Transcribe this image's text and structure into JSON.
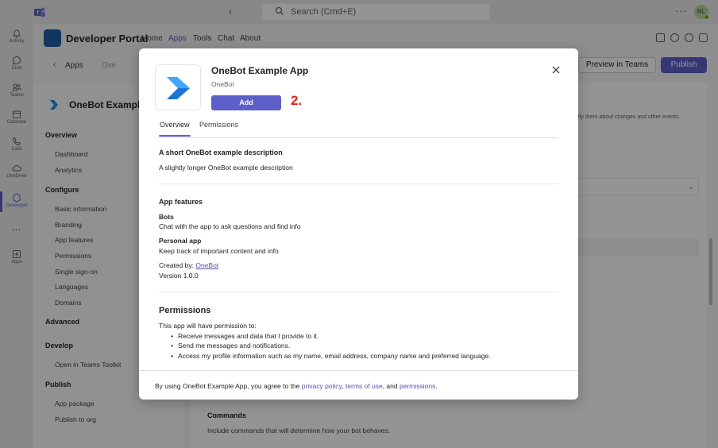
{
  "topbar": {
    "search_placeholder": "Search (Cmd+E)",
    "more": "···",
    "avatar_initials": "RL"
  },
  "rail": {
    "items": [
      {
        "label": "Activity",
        "icon": "bell-icon"
      },
      {
        "label": "Chat",
        "icon": "chat-icon"
      },
      {
        "label": "Teams",
        "icon": "teams-icon"
      },
      {
        "label": "Calendar",
        "icon": "calendar-icon"
      },
      {
        "label": "Calls",
        "icon": "phone-icon"
      },
      {
        "label": "OneDrive",
        "icon": "cloud-icon"
      },
      {
        "label": "Developer",
        "icon": "developer-portal-icon"
      },
      {
        "label": "",
        "icon": "more-icon"
      },
      {
        "label": "Apps",
        "icon": "apps-icon"
      }
    ]
  },
  "header": {
    "title": "Developer Portal",
    "nav": [
      "Home",
      "Apps",
      "Tools",
      "Chat",
      "About"
    ],
    "active_nav": "Apps"
  },
  "subbar": {
    "back": "‹",
    "apps": "Apps",
    "crumb": "Ove",
    "preview_label": "Preview in Teams",
    "publish_label": "Publish"
  },
  "leftnav": {
    "app_name": "OneBot Example",
    "sections": [
      {
        "title": "Overview",
        "items": [
          "Dashboard",
          "Analytics"
        ]
      },
      {
        "title": "Configure",
        "items": [
          "Basic information",
          "Branding",
          "App features",
          "Permissions",
          "Single sign-on",
          "Languages",
          "Domains"
        ]
      },
      {
        "title": "Advanced",
        "items": []
      },
      {
        "title": "Develop",
        "items": [
          "Open in Teams Toolkit"
        ]
      },
      {
        "title": "Publish",
        "items": [
          "App package",
          "Publish to org"
        ]
      }
    ]
  },
  "main": {
    "hint": "ify them about changes and other events.",
    "commands_title": "Commands",
    "commands_desc": "Include commands that will determine how your bot behaves."
  },
  "dialog": {
    "title": "OneBot Example App",
    "developer": "OneBot",
    "add_label": "Add",
    "step_marker": "2.",
    "tabs": [
      "Overview",
      "Permissions"
    ],
    "active_tab": "Overview",
    "short_desc": "A short OneBot example description",
    "long_desc": "A slightly longer OneBot example description",
    "features_title": "App features",
    "features": [
      {
        "title": "Bots",
        "desc": "Chat with the app to ask questions and find info"
      },
      {
        "title": "Personal app",
        "desc": "Keep track of important content and info"
      }
    ],
    "created_by_label": "Created by:",
    "created_by": "OneBot",
    "version": "Version 1.0.0",
    "permissions_title": "Permissions",
    "permissions_intro": "This app will have permission to:",
    "permissions": [
      "Receive messages and data that I provide to it.",
      "Send me messages and notifications.",
      "Access my profile information such as my name, email address, company name and preferred language."
    ],
    "footer": {
      "prefix": "By using OneBot Example App, you agree to the",
      "privacy": "privacy policy",
      "comma": ",",
      "terms": "terms of use",
      "and": ", and",
      "permissions": "permissions",
      "end": "."
    }
  },
  "colors": {
    "accent": "#5b5fc7",
    "step_marker": "#e8220f",
    "link": "#4f52b2"
  }
}
